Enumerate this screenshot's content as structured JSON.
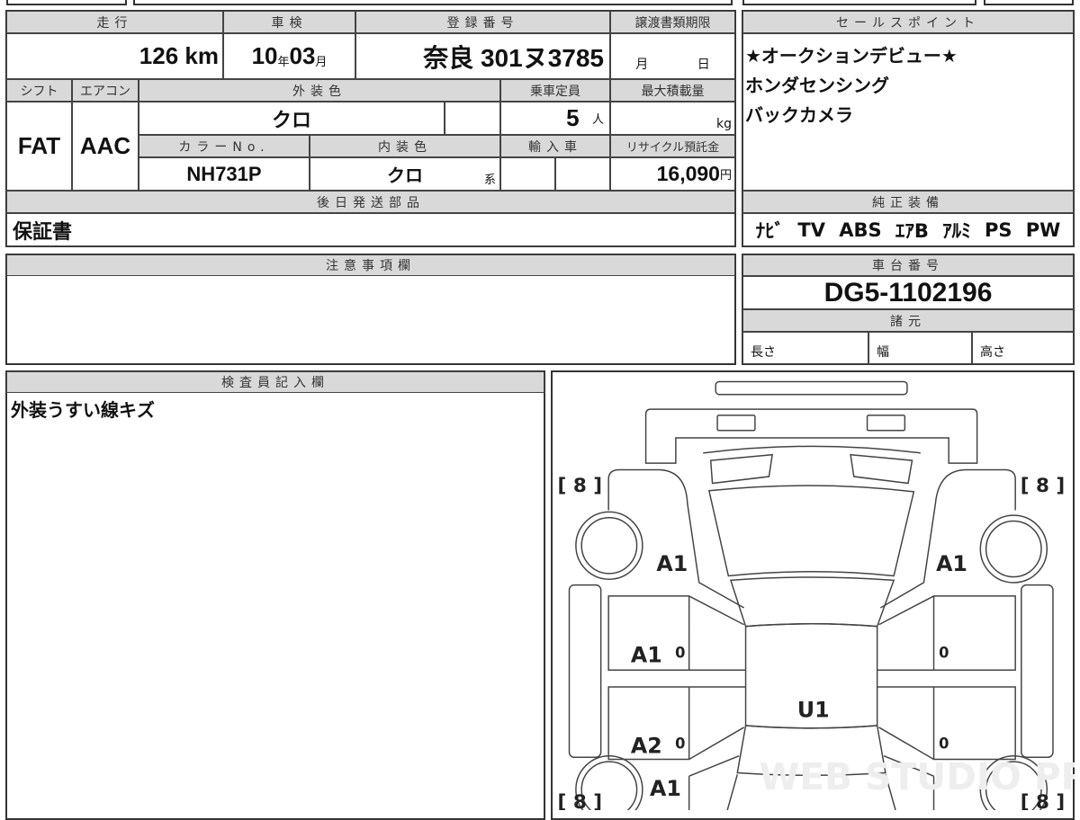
{
  "sheet": {
    "mileage": {
      "label": "走行",
      "value": "126",
      "unit": "km"
    },
    "inspection": {
      "label": "車検",
      "year": "10",
      "year_unit": "年",
      "month": "03",
      "month_unit": "月"
    },
    "registration": {
      "label": "登録番号",
      "value": "奈良 301ヌ3785"
    },
    "transfer_deadline": {
      "label": "譲渡書類期限",
      "month_unit": "月",
      "day_unit": "日"
    },
    "shift": {
      "label": "シフト",
      "value": "FAT"
    },
    "aircon": {
      "label": "エアコン",
      "value": "AAC"
    },
    "exterior_color": {
      "label": "外装色",
      "value": "クロ"
    },
    "capacity": {
      "label": "乗車定員",
      "value": "5",
      "unit": "人"
    },
    "max_load": {
      "label": "最大積載量",
      "unit": "kg"
    },
    "color_no": {
      "label": "カラーNo.",
      "value": "NH731P"
    },
    "interior_color": {
      "label": "内装色",
      "value": "クロ",
      "suffix": "系"
    },
    "imported": {
      "label": "輸入車"
    },
    "recycle_fee": {
      "label": "リサイクル預託金",
      "value": "16,090",
      "unit": "円"
    },
    "later_parts": {
      "label": "後日発送部品",
      "value": "保証書"
    },
    "notes": {
      "label": "注意事項欄"
    },
    "inspector": {
      "label": "検査員記入欄",
      "value": "外装うすい線キズ"
    },
    "sales_points": {
      "label": "セールスポイント",
      "lines": [
        "★オークションデビュー★",
        "ホンダセンシング",
        "バックカメラ"
      ]
    },
    "equipment": {
      "label": "純正装備",
      "items": [
        "ﾅﾋﾞ",
        "TV",
        "ABS",
        "ｴｱB",
        "ｱﾙﾐ",
        "PS",
        "PW"
      ]
    },
    "chassis": {
      "label": "車台番号",
      "value": "DG5-1102196"
    },
    "specs": {
      "label": "諸元",
      "length": "長さ",
      "width": "幅",
      "height": "高さ"
    }
  },
  "diagram": {
    "tires": [
      "[ 8 ]",
      "[ 8 ]",
      "[ 8 ]",
      "[ 8 ]"
    ],
    "marks": {
      "front_left": "A1",
      "front_right": "A1",
      "front_door_left": "A1",
      "rear_door_left": "A2",
      "rear_fender_left": "A1",
      "roof": "U1",
      "door_zero": "0"
    },
    "watermark": "WEB STUDIO PRO"
  }
}
